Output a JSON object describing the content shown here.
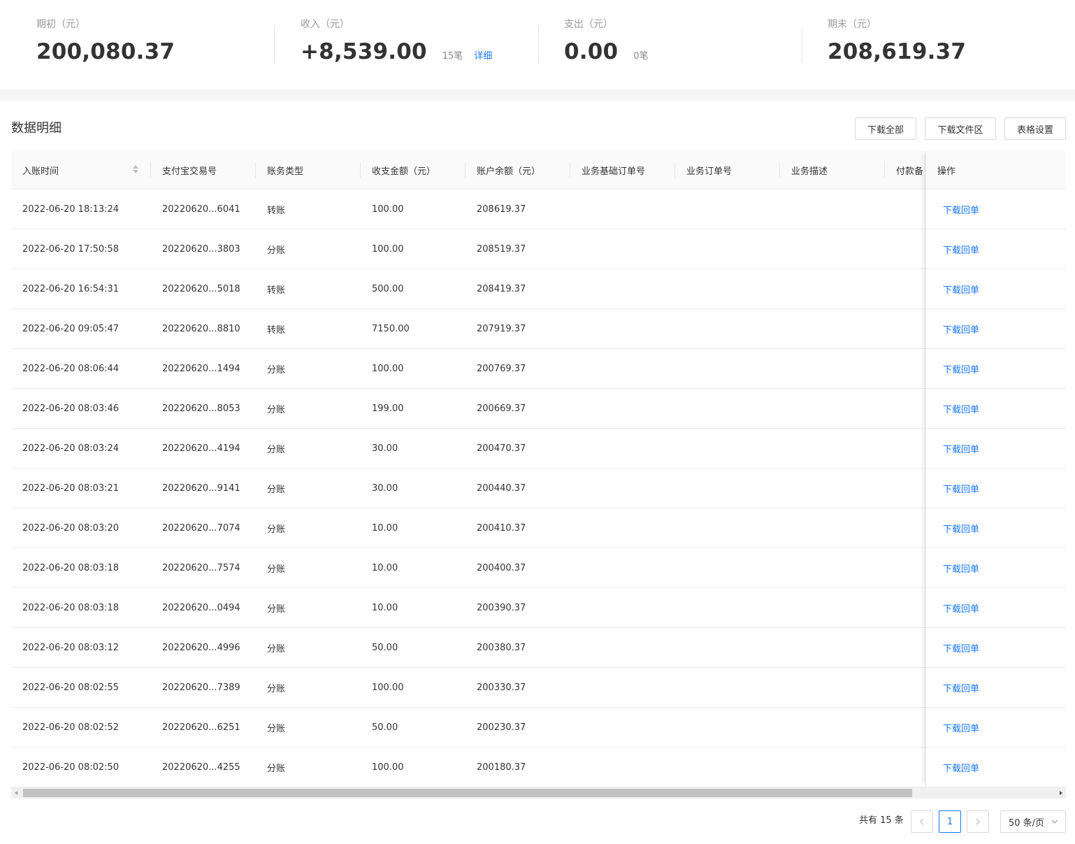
{
  "summary": {
    "opening": {
      "label": "期初（元）",
      "value": "200,080.37"
    },
    "income": {
      "label": "收入（元）",
      "value": "+8,539.00",
      "count": "15笔",
      "detail_link": "详细"
    },
    "expense": {
      "label": "支出（元）",
      "value": "0.00",
      "count": "0笔"
    },
    "closing": {
      "label": "期末（元）",
      "value": "208,619.37"
    }
  },
  "section": {
    "title": "数据明细",
    "download_all": "下载全部",
    "download_folder": "下载文件区",
    "table_settings": "表格设置"
  },
  "table": {
    "columns": [
      "入账时间",
      "支付宝交易号",
      "账务类型",
      "收支金额（元）",
      "账户余额（元）",
      "业务基础订单号",
      "业务订单号",
      "业务描述",
      "付款备",
      "操作"
    ],
    "rows": [
      {
        "time": "2022-06-20 18:13:24",
        "trade_no": "20220620...6041",
        "type": "转账",
        "amount": "100.00",
        "balance": "208619.37",
        "action": "下载回单"
      },
      {
        "time": "2022-06-20 17:50:58",
        "trade_no": "20220620...3803",
        "type": "分账",
        "amount": "100.00",
        "balance": "208519.37",
        "action": "下载回单"
      },
      {
        "time": "2022-06-20 16:54:31",
        "trade_no": "20220620...5018",
        "type": "转账",
        "amount": "500.00",
        "balance": "208419.37",
        "action": "下载回单"
      },
      {
        "time": "2022-06-20 09:05:47",
        "trade_no": "20220620...8810",
        "type": "转账",
        "amount": "7150.00",
        "balance": "207919.37",
        "action": "下载回单"
      },
      {
        "time": "2022-06-20 08:06:44",
        "trade_no": "20220620...1494",
        "type": "分账",
        "amount": "100.00",
        "balance": "200769.37",
        "action": "下载回单"
      },
      {
        "time": "2022-06-20 08:03:46",
        "trade_no": "20220620...8053",
        "type": "分账",
        "amount": "199.00",
        "balance": "200669.37",
        "action": "下载回单"
      },
      {
        "time": "2022-06-20 08:03:24",
        "trade_no": "20220620...4194",
        "type": "分账",
        "amount": "30.00",
        "balance": "200470.37",
        "action": "下载回单"
      },
      {
        "time": "2022-06-20 08:03:21",
        "trade_no": "20220620...9141",
        "type": "分账",
        "amount": "30.00",
        "balance": "200440.37",
        "action": "下载回单"
      },
      {
        "time": "2022-06-20 08:03:20",
        "trade_no": "20220620...7074",
        "type": "分账",
        "amount": "10.00",
        "balance": "200410.37",
        "action": "下载回单"
      },
      {
        "time": "2022-06-20 08:03:18",
        "trade_no": "20220620...7574",
        "type": "分账",
        "amount": "10.00",
        "balance": "200400.37",
        "action": "下载回单"
      },
      {
        "time": "2022-06-20 08:03:18",
        "trade_no": "20220620...0494",
        "type": "分账",
        "amount": "10.00",
        "balance": "200390.37",
        "action": "下载回单"
      },
      {
        "time": "2022-06-20 08:03:12",
        "trade_no": "20220620...4996",
        "type": "分账",
        "amount": "50.00",
        "balance": "200380.37",
        "action": "下载回单"
      },
      {
        "time": "2022-06-20 08:02:55",
        "trade_no": "20220620...7389",
        "type": "分账",
        "amount": "100.00",
        "balance": "200330.37",
        "action": "下载回单"
      },
      {
        "time": "2022-06-20 08:02:52",
        "trade_no": "20220620...6251",
        "type": "分账",
        "amount": "50.00",
        "balance": "200230.37",
        "action": "下载回单"
      },
      {
        "time": "2022-06-20 08:02:50",
        "trade_no": "20220620...4255",
        "type": "分账",
        "amount": "100.00",
        "balance": "200180.37",
        "action": "下载回单"
      }
    ]
  },
  "pagination": {
    "total": "共有 15 条",
    "prev_icon": "chevron-left-icon",
    "current_page": "1",
    "next_icon": "chevron-right-icon",
    "page_size": "50 条/页"
  },
  "colors": {
    "accent": "#1677ff",
    "header_bg": "#fafafa",
    "border": "#ececec"
  }
}
